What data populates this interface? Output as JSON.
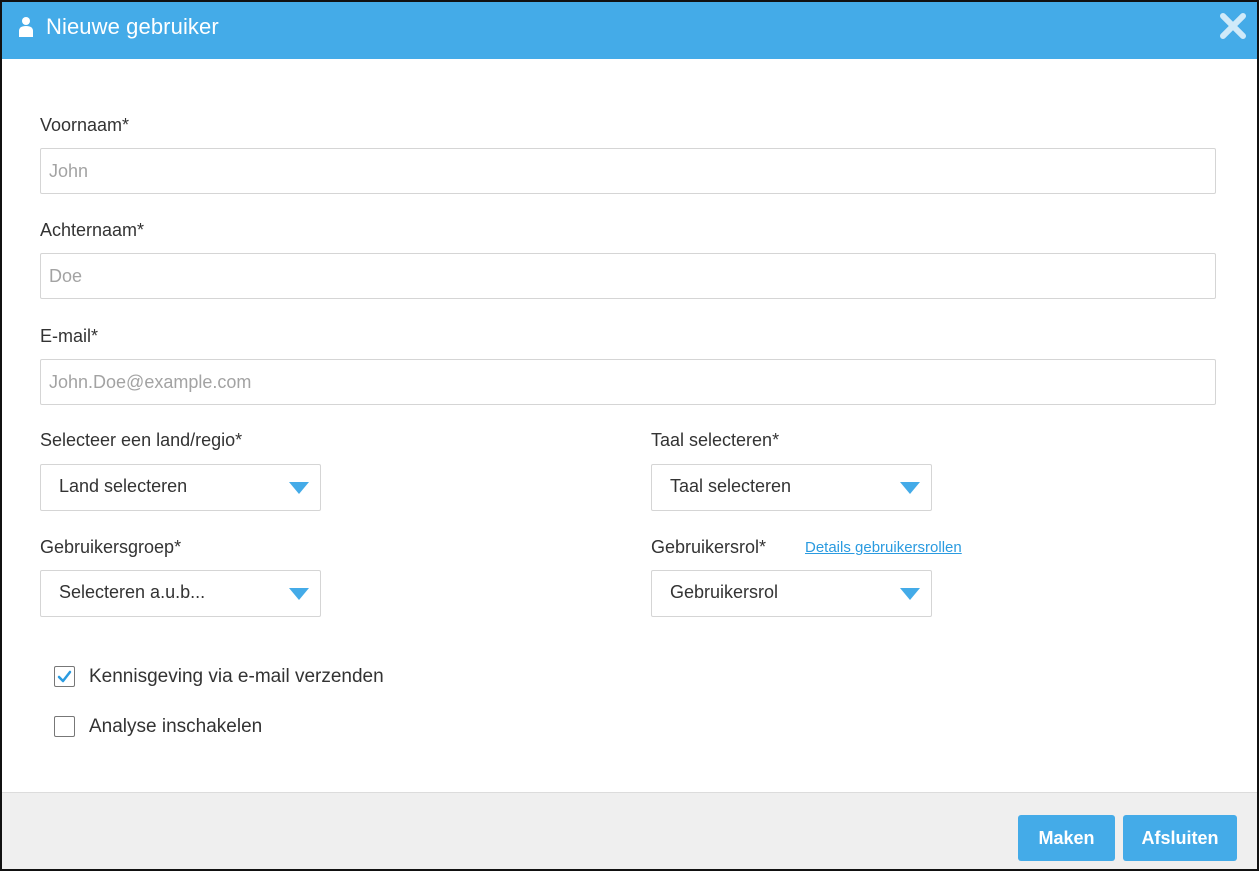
{
  "dialog": {
    "title": "Nieuwe gebruiker",
    "icons": {
      "title": "user-icon",
      "close": "close-icon"
    }
  },
  "colors": {
    "accent": "#44abe8",
    "link": "#2b9be0",
    "footer_bg": "#efefef"
  },
  "form": {
    "first_name": {
      "label": "Voornaam*",
      "placeholder": "John",
      "value": ""
    },
    "last_name": {
      "label": "Achternaam*",
      "placeholder": "Doe",
      "value": ""
    },
    "email": {
      "label": "E-mail*",
      "placeholder": "John.Doe@example.com",
      "value": ""
    },
    "country": {
      "label": "Selecteer een land/regio*",
      "selected": "Land selecteren"
    },
    "language": {
      "label": "Taal selecteren*",
      "selected": "Taal selecteren"
    },
    "user_group": {
      "label": "Gebruikersgroep*",
      "selected": "Selecteren a.u.b..."
    },
    "user_role": {
      "label": "Gebruikersrol*",
      "selected": "Gebruikersrol",
      "details_link": "Details gebruikersrollen"
    },
    "checkboxes": [
      {
        "label": "Kennisgeving via e-mail verzenden",
        "checked": true
      },
      {
        "label": "Analyse inschakelen",
        "checked": false
      }
    ]
  },
  "footer": {
    "create_label": "Maken",
    "close_label": "Afsluiten"
  }
}
